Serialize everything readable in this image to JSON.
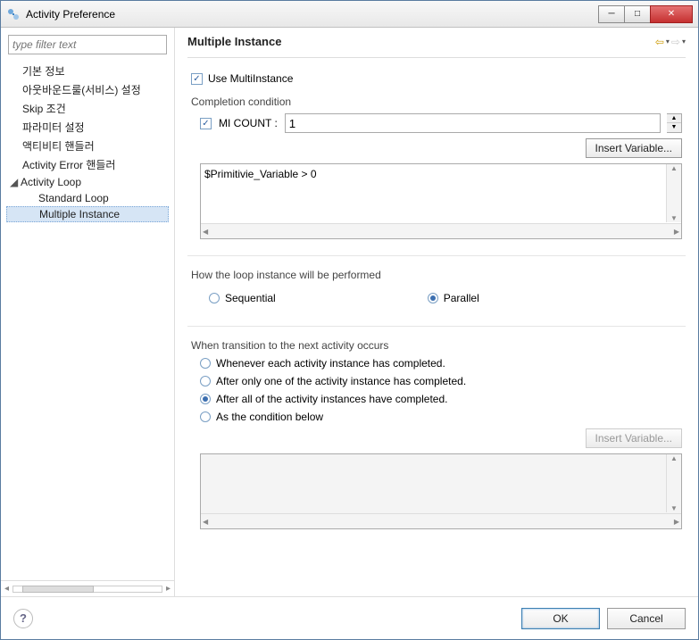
{
  "window": {
    "title": "Activity Preference"
  },
  "sidebar": {
    "filter_placeholder": "type filter text",
    "items": [
      {
        "label": "기본 정보"
      },
      {
        "label": "아웃바운드룰(서비스) 설정"
      },
      {
        "label": "Skip 조건"
      },
      {
        "label": "파라미터 설정"
      },
      {
        "label": "액티비티 핸들러"
      },
      {
        "label": "Activity Error 핸들러"
      },
      {
        "label": "Activity Loop",
        "expanded": true,
        "children": [
          {
            "label": "Standard Loop"
          },
          {
            "label": "Multiple Instance",
            "selected": true
          }
        ]
      }
    ]
  },
  "main": {
    "heading": "Multiple Instance",
    "use_multi": {
      "checked": true,
      "label": "Use MultiInstance"
    },
    "completion": {
      "group_label": "Completion condition",
      "mi_count_checked": true,
      "mi_count_label": "MI COUNT :",
      "mi_count_value": "1",
      "insert_variable_btn": "Insert Variable...",
      "condition_text": "$Primitivie_Variable > 0"
    },
    "perform": {
      "group_label": "How the loop instance will be performed",
      "sequential_label": "Sequential",
      "parallel_label": "Parallel",
      "selected": "parallel"
    },
    "transition": {
      "group_label": "When transition to the next activity occurs",
      "options": [
        "Whenever each activity instance has completed.",
        "After only one of the activity instance has completed.",
        "After all of the activity instances have completed.",
        "As the condition below"
      ],
      "selected_index": 2,
      "insert_variable_btn": "Insert Variable...",
      "condition_text": ""
    }
  },
  "footer": {
    "ok": "OK",
    "cancel": "Cancel"
  }
}
